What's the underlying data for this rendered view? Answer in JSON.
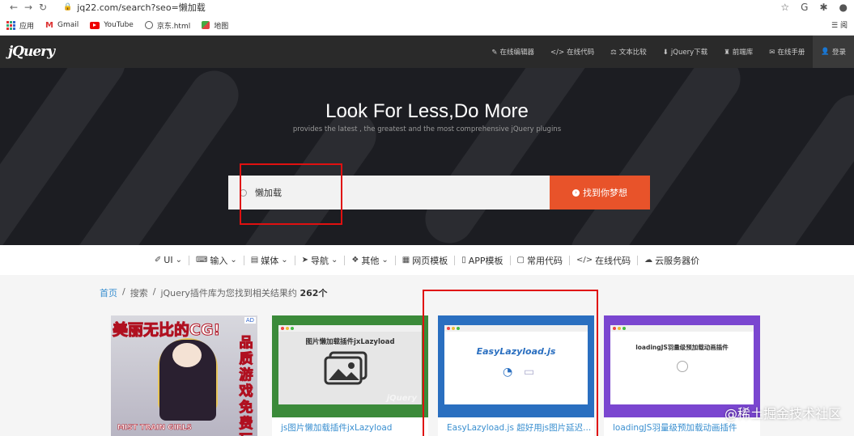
{
  "browser": {
    "url": "jq22.com/search?seo=懒加载",
    "bookmarks": [
      {
        "label": "应用",
        "icon": "apps-grid-icon"
      },
      {
        "label": "Gmail",
        "icon": "gmail-icon"
      },
      {
        "label": "YouTube",
        "icon": "youtube-icon"
      },
      {
        "label": "京东.html",
        "icon": "globe-icon"
      },
      {
        "label": "地图",
        "icon": "maps-icon"
      }
    ],
    "reading_list": "阅"
  },
  "site": {
    "logo_text": "jQuery",
    "top_nav": [
      {
        "label": "在线编辑器",
        "icon": "edit-icon"
      },
      {
        "label": "在线代码",
        "icon": "code-icon"
      },
      {
        "label": "文本比较",
        "icon": "compare-icon"
      },
      {
        "label": "jQuery下载",
        "icon": "download-icon"
      },
      {
        "label": "前端库",
        "icon": "library-icon"
      },
      {
        "label": "在线手册",
        "icon": "manual-icon"
      },
      {
        "label": "登录",
        "icon": "user-icon"
      }
    ]
  },
  "hero": {
    "title": "Look For Less,Do More",
    "subtitle": "provides the latest , the greatest and the most comprehensive jQuery plugins",
    "search_value": "懒加载",
    "search_button": "找到你梦想"
  },
  "categories": [
    {
      "label": "UI",
      "icon": "brush-icon",
      "dropdown": true
    },
    {
      "label": "输入",
      "icon": "keyboard-icon",
      "dropdown": true
    },
    {
      "label": "媒体",
      "icon": "film-icon",
      "dropdown": true
    },
    {
      "label": "导航",
      "icon": "send-icon",
      "dropdown": true
    },
    {
      "label": "其他",
      "icon": "gift-icon",
      "dropdown": true
    },
    {
      "label": "网页模板",
      "icon": "grid-icon",
      "dropdown": false
    },
    {
      "label": "APP模板",
      "icon": "phone-icon",
      "dropdown": false
    },
    {
      "label": "常用代码",
      "icon": "file-icon",
      "dropdown": false
    },
    {
      "label": "在线代码",
      "icon": "code-icon",
      "dropdown": false
    },
    {
      "label": "云服务器价",
      "icon": "cloud-icon",
      "dropdown": false
    }
  ],
  "breadcrumb": {
    "home": "首页",
    "search": "搜索",
    "result_prefix": "jQuery插件库为您找到相关结果约",
    "count": "262个"
  },
  "ad": {
    "headline": "美丽无比的CG!",
    "vertical": "品质游戏免费玩",
    "tag": "AD",
    "brand": "MIST TRAIN GIRLS"
  },
  "cards": [
    {
      "title": "js图片懒加载插件jxLazyload",
      "inner": "图片懒加载插件jxLazyload",
      "color": "#3b8a3a"
    },
    {
      "title": "EasyLazyload.js 超好用js图片延迟...",
      "inner": "EasyLazyload.js",
      "color": "#2a6fc0"
    },
    {
      "title": "loadingJS羽量级预加载动画插件",
      "inner": "loadingJS羽量级预加载动画插件",
      "color": "#7a46d0"
    }
  ],
  "watermark": "@稀土掘金技术社区"
}
